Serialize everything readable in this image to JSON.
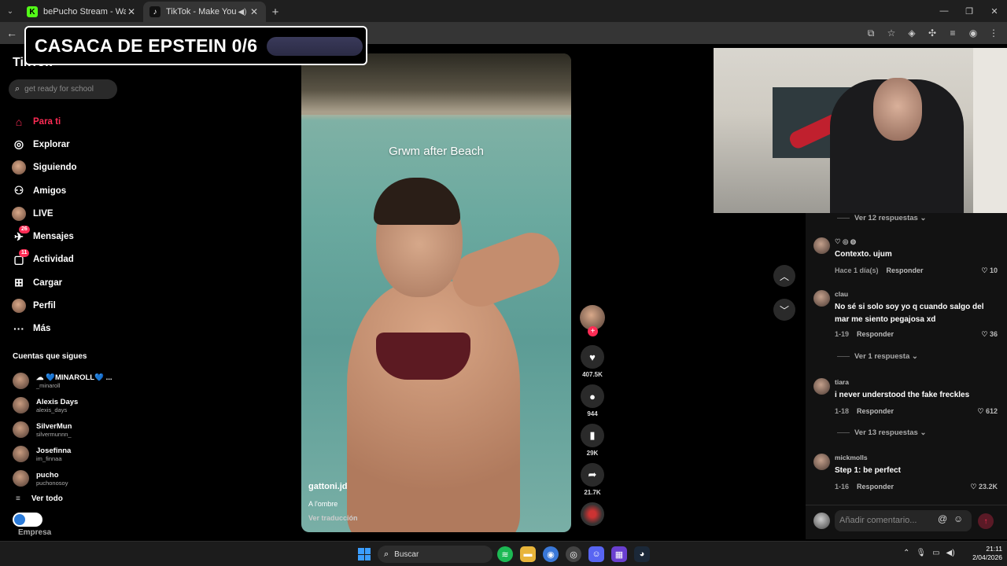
{
  "browser": {
    "tabs": [
      {
        "title": "bePucho Stream - Watch Live o",
        "favicon": "K",
        "color": "#53fc18"
      },
      {
        "title": "TikTok - Make Your Day",
        "favicon": "♪",
        "color": "#111111"
      }
    ]
  },
  "overlay": {
    "title": "CASACA DE EPSTEIN 0/6"
  },
  "tiktok": {
    "logo": "TikTok",
    "search_placeholder": "get ready for school",
    "nav": [
      {
        "label": "Para ti",
        "icon": "home-icon",
        "active": true
      },
      {
        "label": "Explorar",
        "icon": "compass-icon"
      },
      {
        "label": "Siguiendo",
        "icon": "following-avatar-icon"
      },
      {
        "label": "Amigos",
        "icon": "friends-icon"
      },
      {
        "label": "LIVE",
        "icon": "live-icon"
      },
      {
        "label": "Mensajes",
        "icon": "messages-icon",
        "badge": "26"
      },
      {
        "label": "Actividad",
        "icon": "activity-icon",
        "badge": "11"
      },
      {
        "label": "Cargar",
        "icon": "upload-icon"
      },
      {
        "label": "Perfil",
        "icon": "profile-avatar-icon"
      },
      {
        "label": "Más",
        "icon": "more-icon"
      }
    ],
    "following_title": "Cuentas que sigues",
    "following": [
      {
        "name": "☁ 💙MINAROLL💙 ...",
        "handle": "_minaroll"
      },
      {
        "name": "Alexis Days",
        "handle": "alexis_days"
      },
      {
        "name": "SilverMun",
        "handle": "silvermunnn_"
      },
      {
        "name": "Josefinna",
        "handle": "im_finnaa"
      },
      {
        "name": "pucho",
        "handle": "puchonosoy"
      }
    ],
    "see_all": "Ver todo",
    "business": "Empresa"
  },
  "video": {
    "caption": "Grwm after Beach",
    "username": "gattoni.jd",
    "description": "A l'ombre",
    "translate": "Ver traducción",
    "likes": "407.5K",
    "comments": "944",
    "saves": "29K",
    "shares": "21.7K"
  },
  "comments": {
    "list": [
      {
        "user": "♡ ◎ ◍",
        "text": "Contexto. ujum",
        "date": "Hace 1 día(s)",
        "reply": "Responder",
        "likes": "10"
      },
      {
        "user": "clau",
        "text": "No sé si solo soy yo q cuando salgo del mar me siento pegajosa xd",
        "date": "1-19",
        "reply": "Responder",
        "likes": "36"
      },
      {
        "user": "tiara",
        "text": "i never understood the fake freckles",
        "date": "1-18",
        "reply": "Responder",
        "likes": "612"
      },
      {
        "user": "mickmolls",
        "text": "Step 1: be perfect",
        "date": "1-16",
        "reply": "Responder",
        "likes": "23.2K"
      }
    ],
    "view_replies_top": "Ver 12 respuestas",
    "view_replies_1": "Ver 1 respuesta",
    "view_replies_2": "Ver 13 respuestas",
    "input_placeholder": "Añadir comentario..."
  },
  "taskbar": {
    "search": "Buscar",
    "time": "21:11",
    "date": "2/04/2026"
  }
}
